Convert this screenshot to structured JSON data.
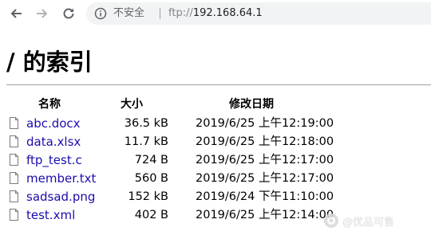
{
  "browser": {
    "security_label": "不安全",
    "url_scheme": "ftp://",
    "url_host": "192.168.64.1"
  },
  "page": {
    "title": "/ 的索引"
  },
  "table": {
    "headers": {
      "name": "名称",
      "size": "大小",
      "modified": "修改日期"
    },
    "rows": [
      {
        "name": "abc.docx",
        "size": "36.5 kB",
        "date": "2019/6/25 上午12:19:00"
      },
      {
        "name": "data.xlsx",
        "size": "11.7 kB",
        "date": "2019/6/25 上午12:18:00"
      },
      {
        "name": "ftp_test.c",
        "size": "724 B",
        "date": "2019/6/25 上午12:17:00"
      },
      {
        "name": "member.txt",
        "size": "560 B",
        "date": "2019/6/25 上午12:17:00"
      },
      {
        "name": "sadsad.png",
        "size": "152 kB",
        "date": "2019/6/24 下午11:10:00"
      },
      {
        "name": "test.xml",
        "size": "402 B",
        "date": "2019/6/25 上午12:14:00"
      }
    ]
  },
  "watermark": {
    "text": "@优品可售"
  },
  "colors": {
    "link": "#1a0dab",
    "omnibox_bg": "#f1f3f4",
    "rule": "#a0a0a0"
  },
  "icons": [
    "back-arrow-icon",
    "forward-arrow-icon",
    "reload-icon",
    "info-icon",
    "file-icon",
    "watermark-logo-icon"
  ]
}
